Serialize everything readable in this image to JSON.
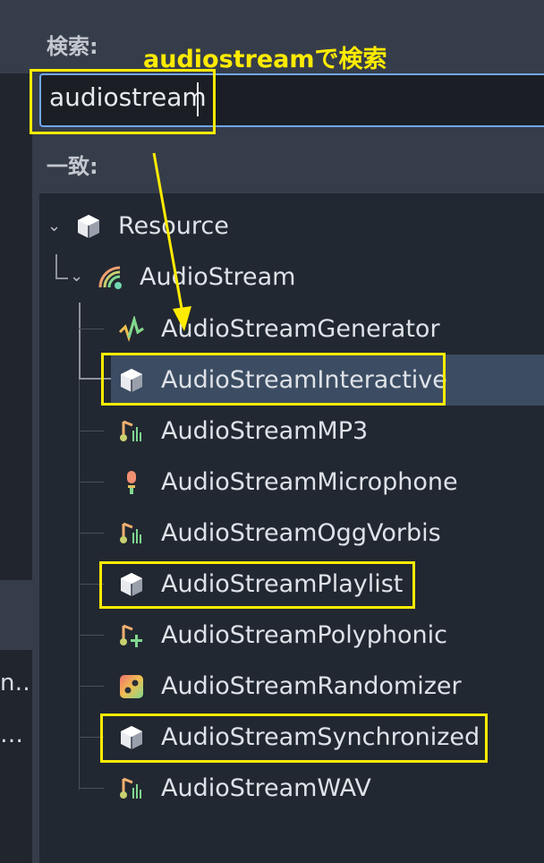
{
  "search": {
    "label": "検索:",
    "value": "audiostream"
  },
  "matches": {
    "label": "一致:"
  },
  "left_panel": {
    "row1": "n…",
    "row2": "…"
  },
  "annotation": {
    "text": "audiostreamで検索",
    "color": "#ffeb00"
  },
  "tree": {
    "root": "Resource",
    "parent": "AudioStream",
    "items": [
      {
        "label": "AudioStreamGenerator",
        "icon": "generator-wave-icon"
      },
      {
        "label": "AudioStreamInteractive",
        "icon": "object-cube-icon",
        "selected": true
      },
      {
        "label": "AudioStreamMP3",
        "icon": "audio-note-icon"
      },
      {
        "label": "AudioStreamMicrophone",
        "icon": "microphone-icon"
      },
      {
        "label": "AudioStreamOggVorbis",
        "icon": "audio-note-icon"
      },
      {
        "label": "AudioStreamPlaylist",
        "icon": "object-cube-icon"
      },
      {
        "label": "AudioStreamPolyphonic",
        "icon": "note-plus-icon"
      },
      {
        "label": "AudioStreamRandomizer",
        "icon": "randomizer-dice-icon"
      },
      {
        "label": "AudioStreamSynchronized",
        "icon": "object-cube-icon"
      },
      {
        "label": "AudioStreamWAV",
        "icon": "audio-note-icon"
      }
    ]
  },
  "colors": {
    "accent": "#6fa6e8",
    "selection": "#3c4d63",
    "annotation": "#ffeb00"
  }
}
